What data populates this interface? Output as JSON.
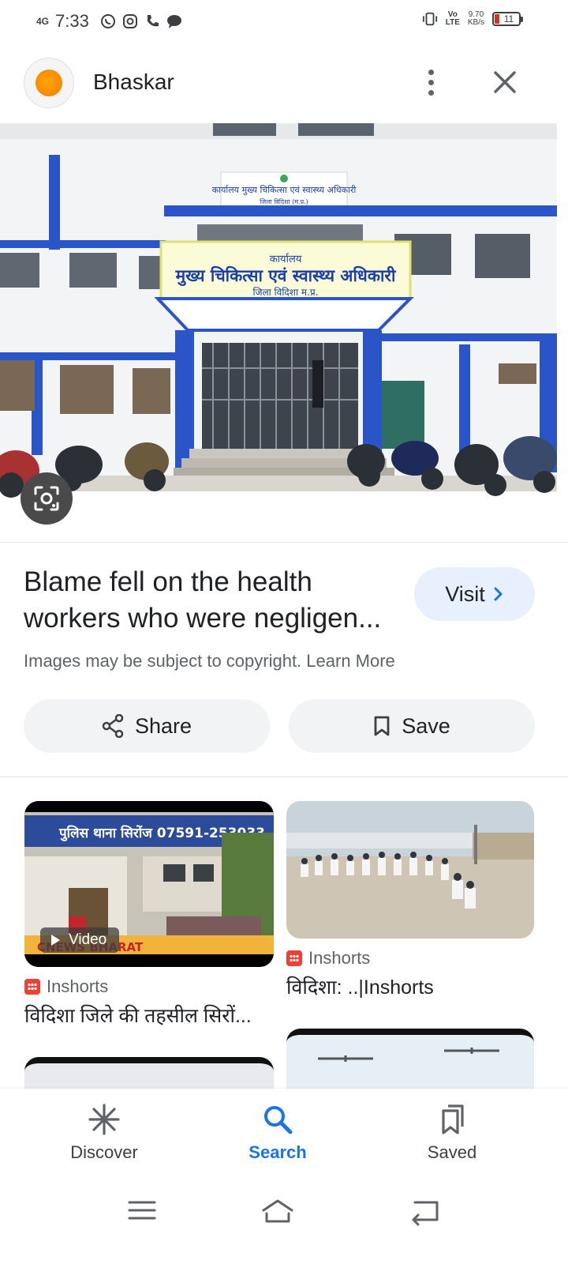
{
  "status_bar": {
    "network": "4G",
    "time": "7:33",
    "speed_value": "9.70",
    "speed_unit": "KB/s",
    "volte": "Vo))\nLTE",
    "battery": "11",
    "icons": [
      "whatsapp-icon",
      "instagram-icon",
      "phone-icon",
      "chat-icon",
      "vibrate-icon"
    ]
  },
  "header": {
    "source_name": "Bhaskar",
    "logo_color": "#f47b00"
  },
  "hero": {
    "signboard_top": "कार्यालय मुख्य चिकित्सा एवं स्वास्थ्य अधिकारी",
    "signboard_top_sub": "जिला विदिशा (म.प्र.)",
    "signboard_main_small": "कार्यालय",
    "signboard_main": "मुख्य चिकित्सा एवं स्वास्थ्य अधिकारी",
    "signboard_main_sub": "जिला विदिशा म.प्र."
  },
  "result": {
    "title": "Blame fell on the health workers who were negligen...",
    "visit_label": "Visit",
    "copyright_text": "Images may be subject to copyright. Learn More"
  },
  "actions": {
    "share_label": "Share",
    "save_label": "Save"
  },
  "related": [
    {
      "source": "Inshorts",
      "title": "विदिशा जिले की तहसील सिरों...",
      "badge": "Video",
      "banner_text": "पुलिस थाना सिरोंज  07591-253033",
      "channel": "CNEWS BHARAT"
    },
    {
      "source": "Inshorts",
      "title": "विदिशा: ..|Inshorts"
    }
  ],
  "bottom_nav": {
    "items": [
      {
        "label": "Discover",
        "icon": "asterisk-icon"
      },
      {
        "label": "Search",
        "icon": "search-icon",
        "active": true
      },
      {
        "label": "Saved",
        "icon": "bookmarks-icon"
      }
    ],
    "accent_color": "#1a73e8"
  }
}
